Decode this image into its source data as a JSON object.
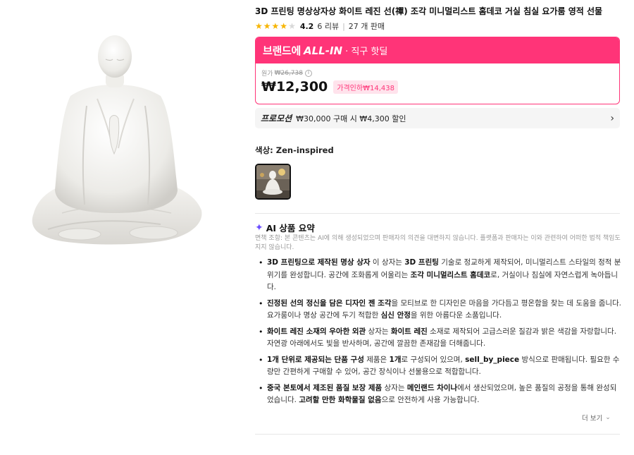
{
  "product": {
    "title": "3D 프린팅 명상상자상 화이트 레진 선(禪) 조각 미니멀리스트 홈데코 거실 침실 요가룸 영적 선물",
    "rating": "4.2",
    "rating_value": 4.2,
    "review_count": "6 리뷰",
    "sales_count": "27 개 판매"
  },
  "promo": {
    "brand_text": "브랜드에",
    "allin_text": "ALL-IN",
    "suffix": "· 직구 핫딜",
    "original_label": "원가",
    "original_price": "₩26,738",
    "price": "₩12,300",
    "discount_tag": "가격인하₩14,438"
  },
  "promotion": {
    "label": "프로모션",
    "text": "₩30,000 구매 시 ₩4,300 할인"
  },
  "color": {
    "label": "색상: Zen-inspired"
  },
  "ai_summary": {
    "title": "AI 상품 요약",
    "disclaimer": "면책 조항: 본 콘텐츠는 AI에 의해 생성되었으며 판매자의 의견을 대변하지 않습니다. 플랫폼과 판매자는 이와 관련하여 어떠한 법적 책임도 지지 않습니다.",
    "items": [
      {
        "parts": [
          {
            "t": "3D 프린팅으로 제작된 명상 상자",
            "b": true
          },
          {
            "t": " 이 상자는 ",
            "b": false
          },
          {
            "t": "3D 프린팅",
            "b": true
          },
          {
            "t": " 기술로 정교하게 제작되어, 미니멀리스트 스타일의 정적 분위기를 완성합니다. 공간에 조화롭게 어울리는 ",
            "b": false
          },
          {
            "t": "조각 미니멀리스트 홈데코",
            "b": true
          },
          {
            "t": "로, 거실이나 침실에 자연스럽게 녹아듭니다.",
            "b": false
          }
        ]
      },
      {
        "parts": [
          {
            "t": "진정된 선의 정신을 담은 디자인 젠 조각",
            "b": true
          },
          {
            "t": "을 모티브로 한 디자인은 마음을 가다듬고 평온함을 찾는 데 도움을 줍니다. 요가룸이나 명상 공간에 두기 적합한 ",
            "b": false
          },
          {
            "t": "심신 안정",
            "b": true
          },
          {
            "t": "을 위한 아름다운 소품입니다.",
            "b": false
          }
        ]
      },
      {
        "parts": [
          {
            "t": "화이트 레진 소재의 우아한 외관",
            "b": true
          },
          {
            "t": " 상자는 ",
            "b": false
          },
          {
            "t": "화이트 레진",
            "b": true
          },
          {
            "t": " 소재로 제작되어 고급스러운 질감과 밝은 색감을 자랑합니다. 자연광 아래에서도 빛을 반사하며, 공간에 깔끔한 존재감을 더해줍니다.",
            "b": false
          }
        ]
      },
      {
        "parts": [
          {
            "t": "1개 단위로 제공되는 단품 구성",
            "b": true
          },
          {
            "t": " 제품은 ",
            "b": false
          },
          {
            "t": "1개",
            "b": true
          },
          {
            "t": "로 구성되어 있으며, ",
            "b": false
          },
          {
            "t": "sell_by_piece",
            "b": true
          },
          {
            "t": " 방식으로 판매됩니다. 필요한 수량만 간편하게 구매할 수 있어, 공간 장식이나 선물용으로 적합합니다.",
            "b": false
          }
        ]
      },
      {
        "parts": [
          {
            "t": "중국 본토에서 제조된 품질 보장 제품",
            "b": true
          },
          {
            "t": " 상자는 ",
            "b": false
          },
          {
            "t": "메인랜드 차이나",
            "b": true
          },
          {
            "t": "에서 생산되었으며, 높은 품질의 공정을 통해 완성되었습니다. ",
            "b": false
          },
          {
            "t": "고려할 만한 화학물질 없음",
            "b": true
          },
          {
            "t": "으로 안전하게 사용 가능합니다.",
            "b": false
          }
        ]
      }
    ],
    "more_label": "더 보기"
  },
  "icons": {
    "star": "star-icon",
    "info": "info-icon",
    "chevron_right": "chevron-right-icon",
    "sparkle": "sparkle-icon",
    "chevron_down": "chevron-down-icon"
  },
  "colors": {
    "accent_pink": "#ff3478",
    "star_gold": "#f7b500",
    "sparkle_purple": "#6b4eff"
  }
}
